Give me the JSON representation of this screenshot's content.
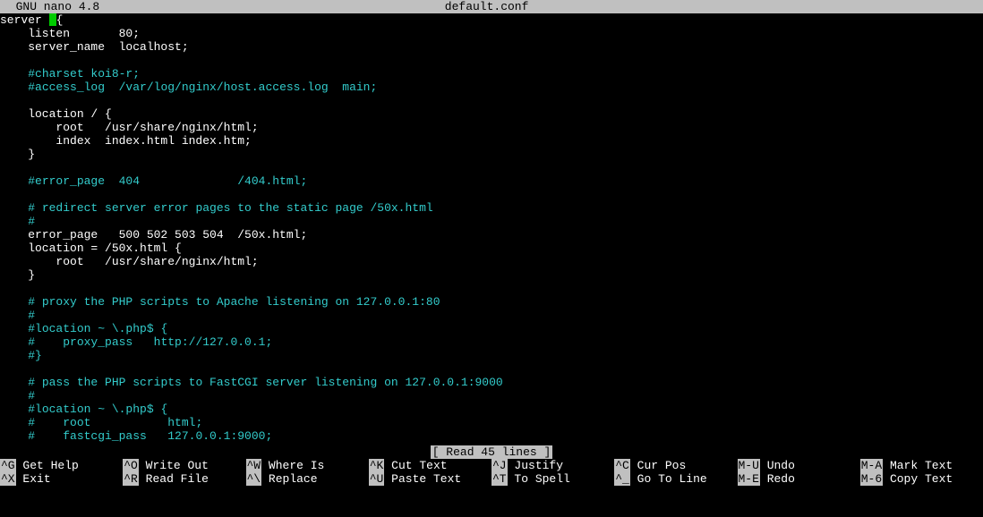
{
  "titlebar": {
    "app": "  GNU nano 4.8",
    "filename": "default.conf"
  },
  "lines": [
    {
      "segs": [
        {
          "t": "server ",
          "c": "white"
        },
        {
          "cursor": true
        },
        {
          "t": "{",
          "c": "white"
        }
      ]
    },
    {
      "segs": [
        {
          "t": "    listen       80;",
          "c": "white"
        }
      ]
    },
    {
      "segs": [
        {
          "t": "    server_name  localhost;",
          "c": "white"
        }
      ]
    },
    {
      "segs": []
    },
    {
      "segs": [
        {
          "t": "    ",
          "c": "white"
        },
        {
          "t": "#charset koi8-r;",
          "c": "cyan"
        }
      ]
    },
    {
      "segs": [
        {
          "t": "    ",
          "c": "white"
        },
        {
          "t": "#access_log  /var/log/nginx/host.access.log  main;",
          "c": "cyan"
        }
      ]
    },
    {
      "segs": []
    },
    {
      "segs": [
        {
          "t": "    location / {",
          "c": "white"
        }
      ]
    },
    {
      "segs": [
        {
          "t": "        root   /usr/share/nginx/html;",
          "c": "white"
        }
      ]
    },
    {
      "segs": [
        {
          "t": "        index  index.html index.htm;",
          "c": "white"
        }
      ]
    },
    {
      "segs": [
        {
          "t": "    }",
          "c": "white"
        }
      ]
    },
    {
      "segs": []
    },
    {
      "segs": [
        {
          "t": "    ",
          "c": "white"
        },
        {
          "t": "#error_page  404              /404.html;",
          "c": "cyan"
        }
      ]
    },
    {
      "segs": []
    },
    {
      "segs": [
        {
          "t": "    ",
          "c": "white"
        },
        {
          "t": "# redirect server error pages to the static page /50x.html",
          "c": "cyan"
        }
      ]
    },
    {
      "segs": [
        {
          "t": "    ",
          "c": "white"
        },
        {
          "t": "#",
          "c": "cyan"
        }
      ]
    },
    {
      "segs": [
        {
          "t": "    error_page   500 502 503 504  /50x.html;",
          "c": "white"
        }
      ]
    },
    {
      "segs": [
        {
          "t": "    location = /50x.html {",
          "c": "white"
        }
      ]
    },
    {
      "segs": [
        {
          "t": "        root   /usr/share/nginx/html;",
          "c": "white"
        }
      ]
    },
    {
      "segs": [
        {
          "t": "    }",
          "c": "white"
        }
      ]
    },
    {
      "segs": []
    },
    {
      "segs": [
        {
          "t": "    ",
          "c": "white"
        },
        {
          "t": "# proxy the PHP scripts to Apache listening on 127.0.0.1:80",
          "c": "cyan"
        }
      ]
    },
    {
      "segs": [
        {
          "t": "    ",
          "c": "white"
        },
        {
          "t": "#",
          "c": "cyan"
        }
      ]
    },
    {
      "segs": [
        {
          "t": "    ",
          "c": "white"
        },
        {
          "t": "#location ~ \\.php$ {",
          "c": "cyan"
        }
      ]
    },
    {
      "segs": [
        {
          "t": "    ",
          "c": "white"
        },
        {
          "t": "#    proxy_pass   http://127.0.0.1;",
          "c": "cyan"
        }
      ]
    },
    {
      "segs": [
        {
          "t": "    ",
          "c": "white"
        },
        {
          "t": "#}",
          "c": "cyan"
        }
      ]
    },
    {
      "segs": []
    },
    {
      "segs": [
        {
          "t": "    ",
          "c": "white"
        },
        {
          "t": "# pass the PHP scripts to FastCGI server listening on 127.0.0.1:9000",
          "c": "cyan"
        }
      ]
    },
    {
      "segs": [
        {
          "t": "    ",
          "c": "white"
        },
        {
          "t": "#",
          "c": "cyan"
        }
      ]
    },
    {
      "segs": [
        {
          "t": "    ",
          "c": "white"
        },
        {
          "t": "#location ~ \\.php$ {",
          "c": "cyan"
        }
      ]
    },
    {
      "segs": [
        {
          "t": "    ",
          "c": "white"
        },
        {
          "t": "#    root           html;",
          "c": "cyan"
        }
      ]
    },
    {
      "segs": [
        {
          "t": "    ",
          "c": "white"
        },
        {
          "t": "#    fastcgi_pass   127.0.0.1:9000;",
          "c": "cyan"
        }
      ]
    }
  ],
  "status": "[ Read 45 lines ]",
  "help": {
    "row1": [
      {
        "key": "^G",
        "label": " Get Help"
      },
      {
        "key": "^O",
        "label": " Write Out"
      },
      {
        "key": "^W",
        "label": " Where Is"
      },
      {
        "key": "^K",
        "label": " Cut Text"
      },
      {
        "key": "^J",
        "label": " Justify"
      },
      {
        "key": "^C",
        "label": " Cur Pos"
      },
      {
        "key": "M-U",
        "label": " Undo"
      },
      {
        "key": "M-A",
        "label": " Mark Text"
      }
    ],
    "row2": [
      {
        "key": "^X",
        "label": " Exit"
      },
      {
        "key": "^R",
        "label": " Read File"
      },
      {
        "key": "^\\",
        "label": " Replace"
      },
      {
        "key": "^U",
        "label": " Paste Text"
      },
      {
        "key": "^T",
        "label": " To Spell"
      },
      {
        "key": "^_",
        "label": " Go To Line"
      },
      {
        "key": "M-E",
        "label": " Redo"
      },
      {
        "key": "M-6",
        "label": " Copy Text"
      }
    ]
  }
}
